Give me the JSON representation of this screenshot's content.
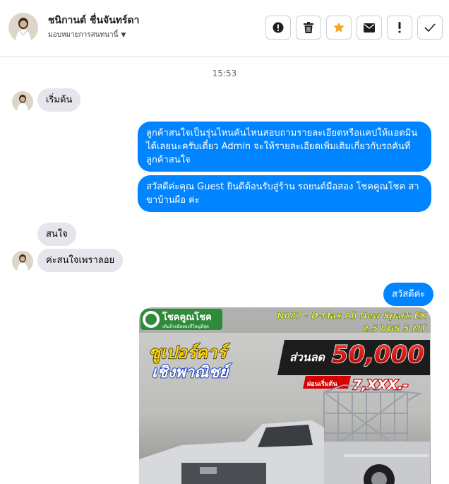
{
  "header": {
    "name": "ชนิกานต์ ชื่นจันทร์ดา",
    "assign_label": "มอบหมายการสนทนานี้",
    "actions": [
      "alert-icon",
      "trash-icon",
      "star-icon",
      "mail-icon",
      "exclamation-icon",
      "check-icon"
    ],
    "star_color": "#f5a623"
  },
  "chat": {
    "time": "15:53",
    "messages": [
      {
        "side": "in",
        "text": "เริ่มต้น"
      },
      {
        "side": "out",
        "text": "ลูกค้าสนใจเป็นรุ่นไหนคันไหนสอบถามรายละเอียดหรือแคปให้แอดมินได้เลยนะครับเดี๋ยว Admin จะให้รายละเอียดเพิ่มเติมเกี่ยวกับรถคันที่ลูกค้าสนใจ"
      },
      {
        "side": "out",
        "text": "สวัสดีค่ะคุณ Guest ยินดีต้อนรับสู่ร้าน รถยนต์มือสอง โชคคูณโชค สาขาบ้านผือ ค่ะ"
      },
      {
        "side": "in",
        "text": "สนใจ"
      },
      {
        "side": "in",
        "text": "ค่ะสนใจเพราลอย"
      },
      {
        "side": "out",
        "text": "สวัสดีค่ะ"
      }
    ],
    "outgoing_color": "#0084ff",
    "incoming_color": "#e4e6eb"
  },
  "promo": {
    "brand": "โชคคูณโชค",
    "brand_tagline": "เติมที่รถมือสองที่ใหญ่ที่สุด",
    "model": "N087 - D-Max All New Spark EX",
    "spec": "2.5 VGS 5 MT",
    "headline_1": "ซูเปอร์คาร์",
    "headline_2": "เชิงพาณิชย์",
    "discount_label": "ส่วนลด",
    "discount_value": "50,000",
    "installment_label": "ผ่อนเริ่มต้น",
    "installment_value": "7,XXX.-"
  }
}
